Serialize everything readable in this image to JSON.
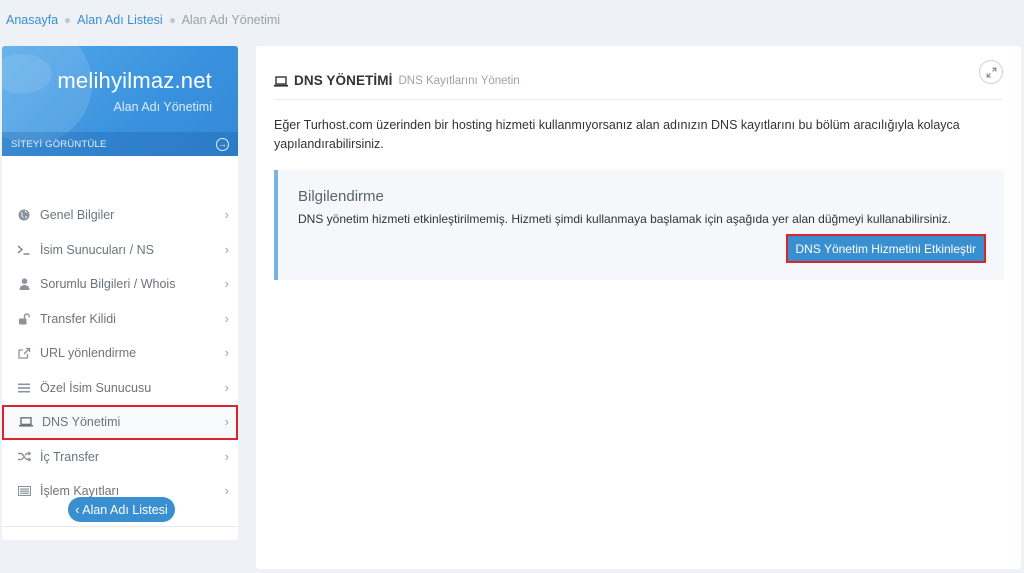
{
  "breadcrumb": {
    "home": "Anasayfa",
    "list": "Alan Adı Listesi",
    "current": "Alan Adı Yönetimi"
  },
  "sidebar": {
    "domain": "melihyilmaz.net",
    "domain_sub": "Alan Adı Yönetimi",
    "view_site": "SİTEYİ GÖRÜNTÜLE",
    "items": [
      {
        "label": "Genel Bilgiler",
        "icon": "globe-icon"
      },
      {
        "label": "İsim Sunucuları / NS",
        "icon": "terminal-icon"
      },
      {
        "label": "Sorumlu Bilgileri / Whois",
        "icon": "user-icon"
      },
      {
        "label": "Transfer Kilidi",
        "icon": "unlock-icon"
      },
      {
        "label": "URL yönlendirme",
        "icon": "share-icon"
      },
      {
        "label": "Özel İsim Sunucusu",
        "icon": "list-icon"
      },
      {
        "label": "DNS Yönetimi",
        "icon": "laptop-icon",
        "active": true
      },
      {
        "label": "İç Transfer",
        "icon": "shuffle-icon"
      },
      {
        "label": "İşlem Kayıtları",
        "icon": "list-alt-icon"
      }
    ],
    "back_button": "‹ Alan Adı Listesi"
  },
  "panel": {
    "title": "DNS YÖNETİMİ",
    "subtitle": "DNS Kayıtlarını Yönetin",
    "description": "Eğer Turhost.com üzerinden bir hosting hizmeti kullanmıyorsanız alan adınızın DNS kayıtlarını bu bölüm aracılığıyla kolayca yapılandırabilirsiniz.",
    "note_title": "Bilgilendirme",
    "note_text": "DNS yönetim hizmeti etkinleştirilmemiş. Hizmeti şimdi kullanmaya başlamak için aşağıda yer alan düğmeyi kullanabilirsiniz.",
    "enable_button": "DNS Yönetim Hizmetini Etkinleştir"
  },
  "colors": {
    "accent": "#3a8fd1",
    "highlight_border": "#d9262c",
    "note_border": "#7ab2e4"
  }
}
